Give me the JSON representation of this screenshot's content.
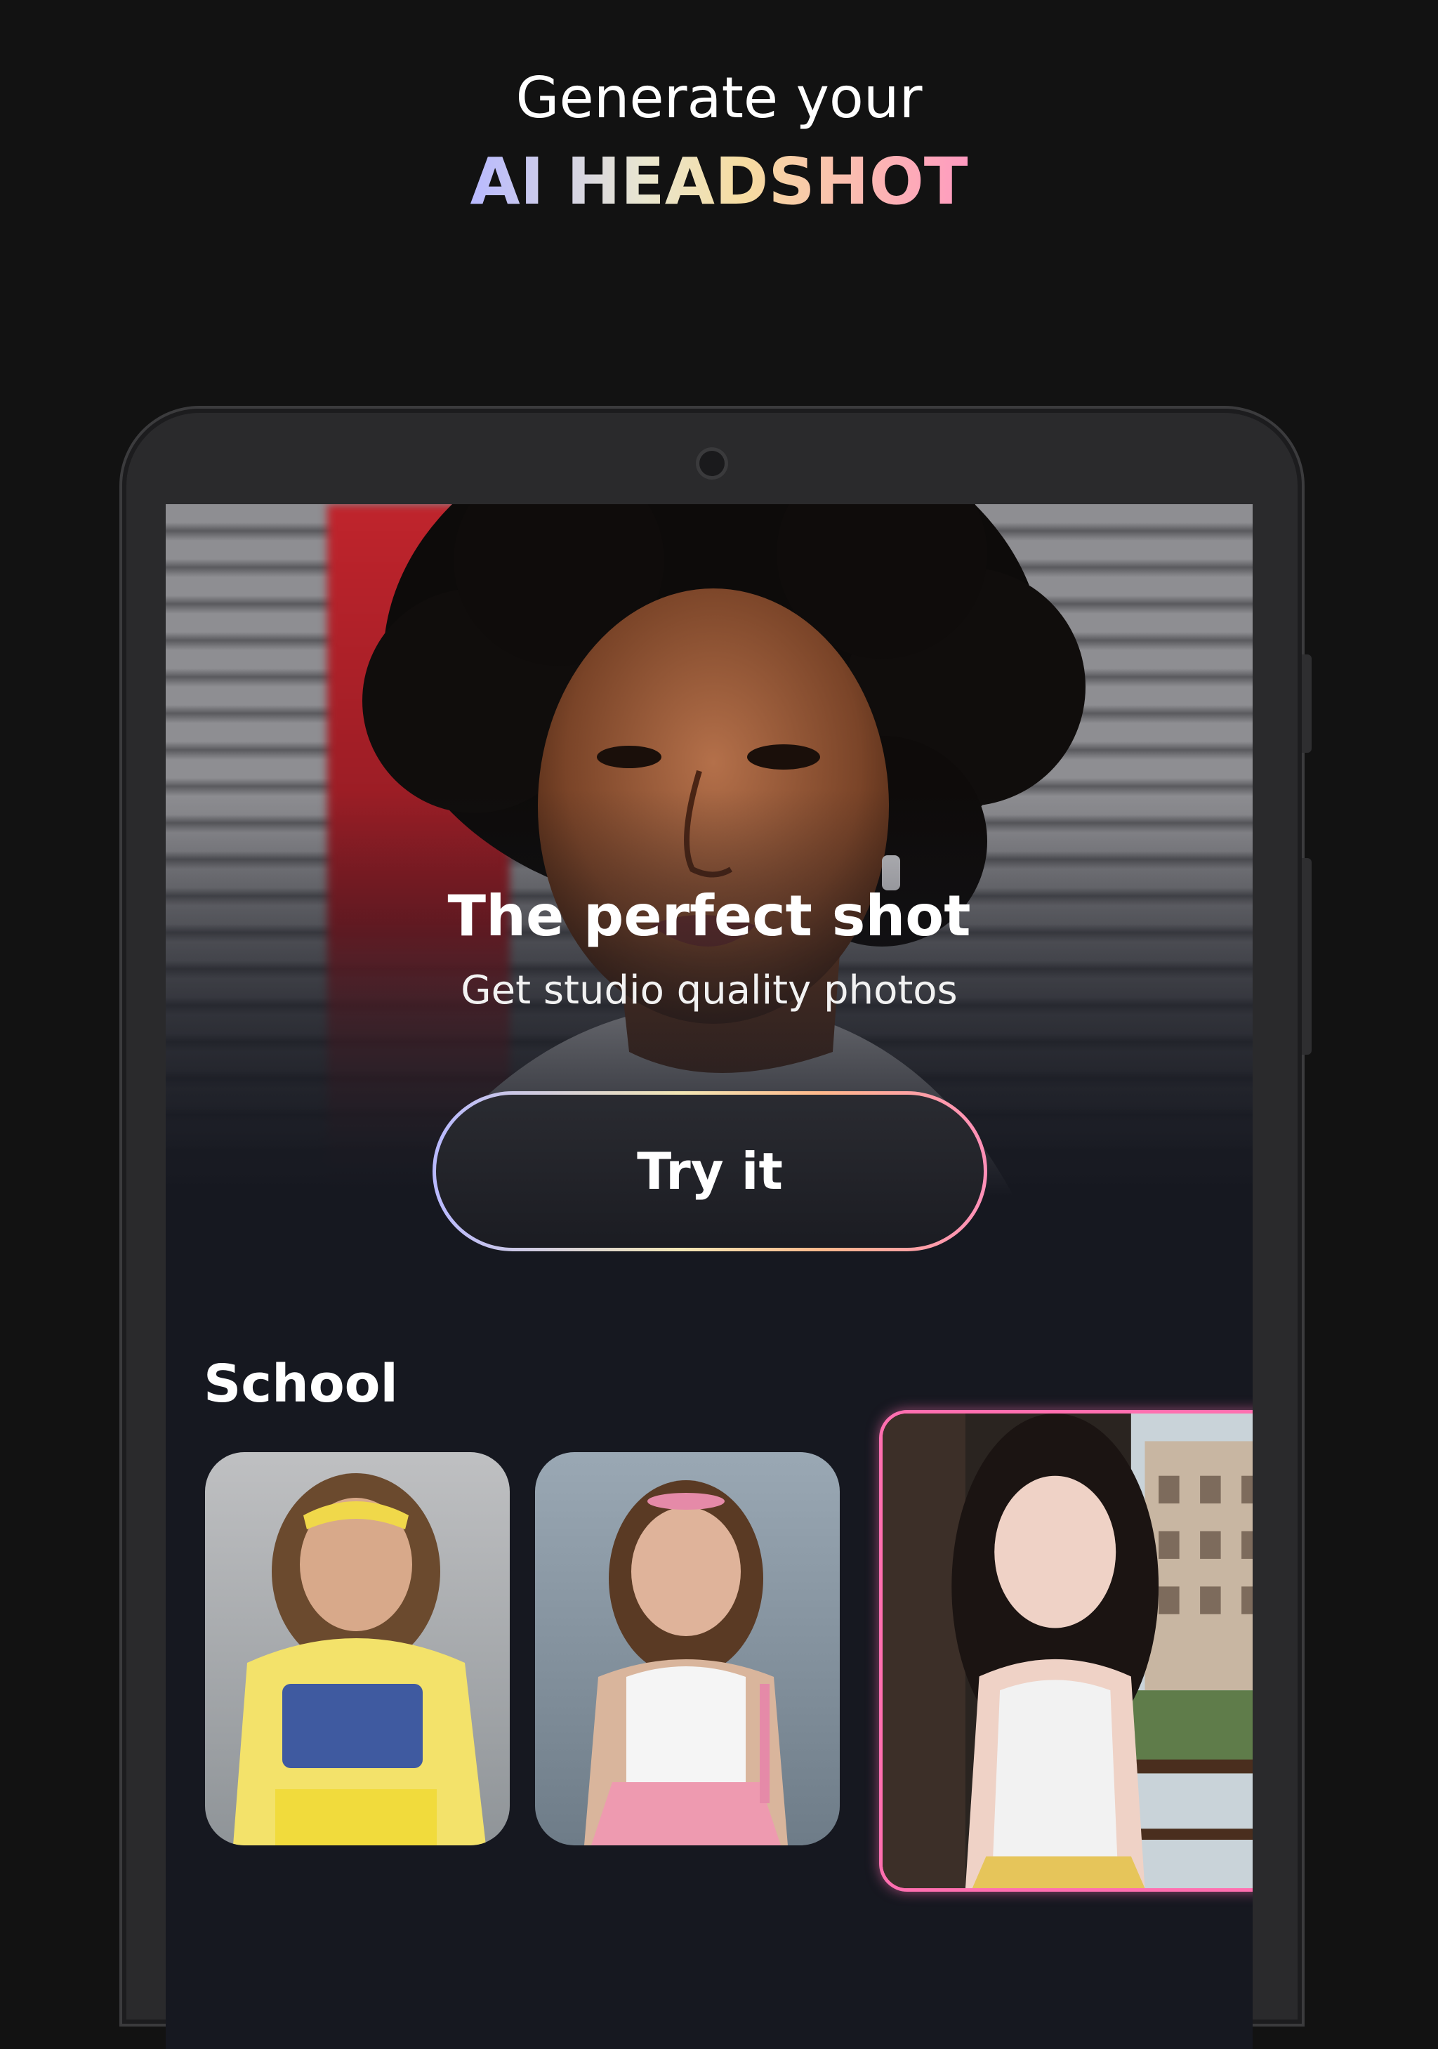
{
  "header": {
    "line1": "Generate your",
    "line2": "AI HEADSHOT"
  },
  "hero": {
    "title": "The perfect shot",
    "subtitle": "Get studio quality photos",
    "cta_label": "Try it"
  },
  "section": {
    "title": "School",
    "cards": [
      {
        "label": "school-style-yellow-outfit"
      },
      {
        "label": "school-style-white-top-pink-skirt"
      },
      {
        "label": "school-style-balcony-selected",
        "selected": true
      }
    ]
  },
  "colors": {
    "background": "#121212",
    "screen": "#161820",
    "accent_gradient": [
      "#b8b9ff",
      "#f3e6b4",
      "#ff8fb8"
    ],
    "selected_border": "#ff6fb0"
  }
}
